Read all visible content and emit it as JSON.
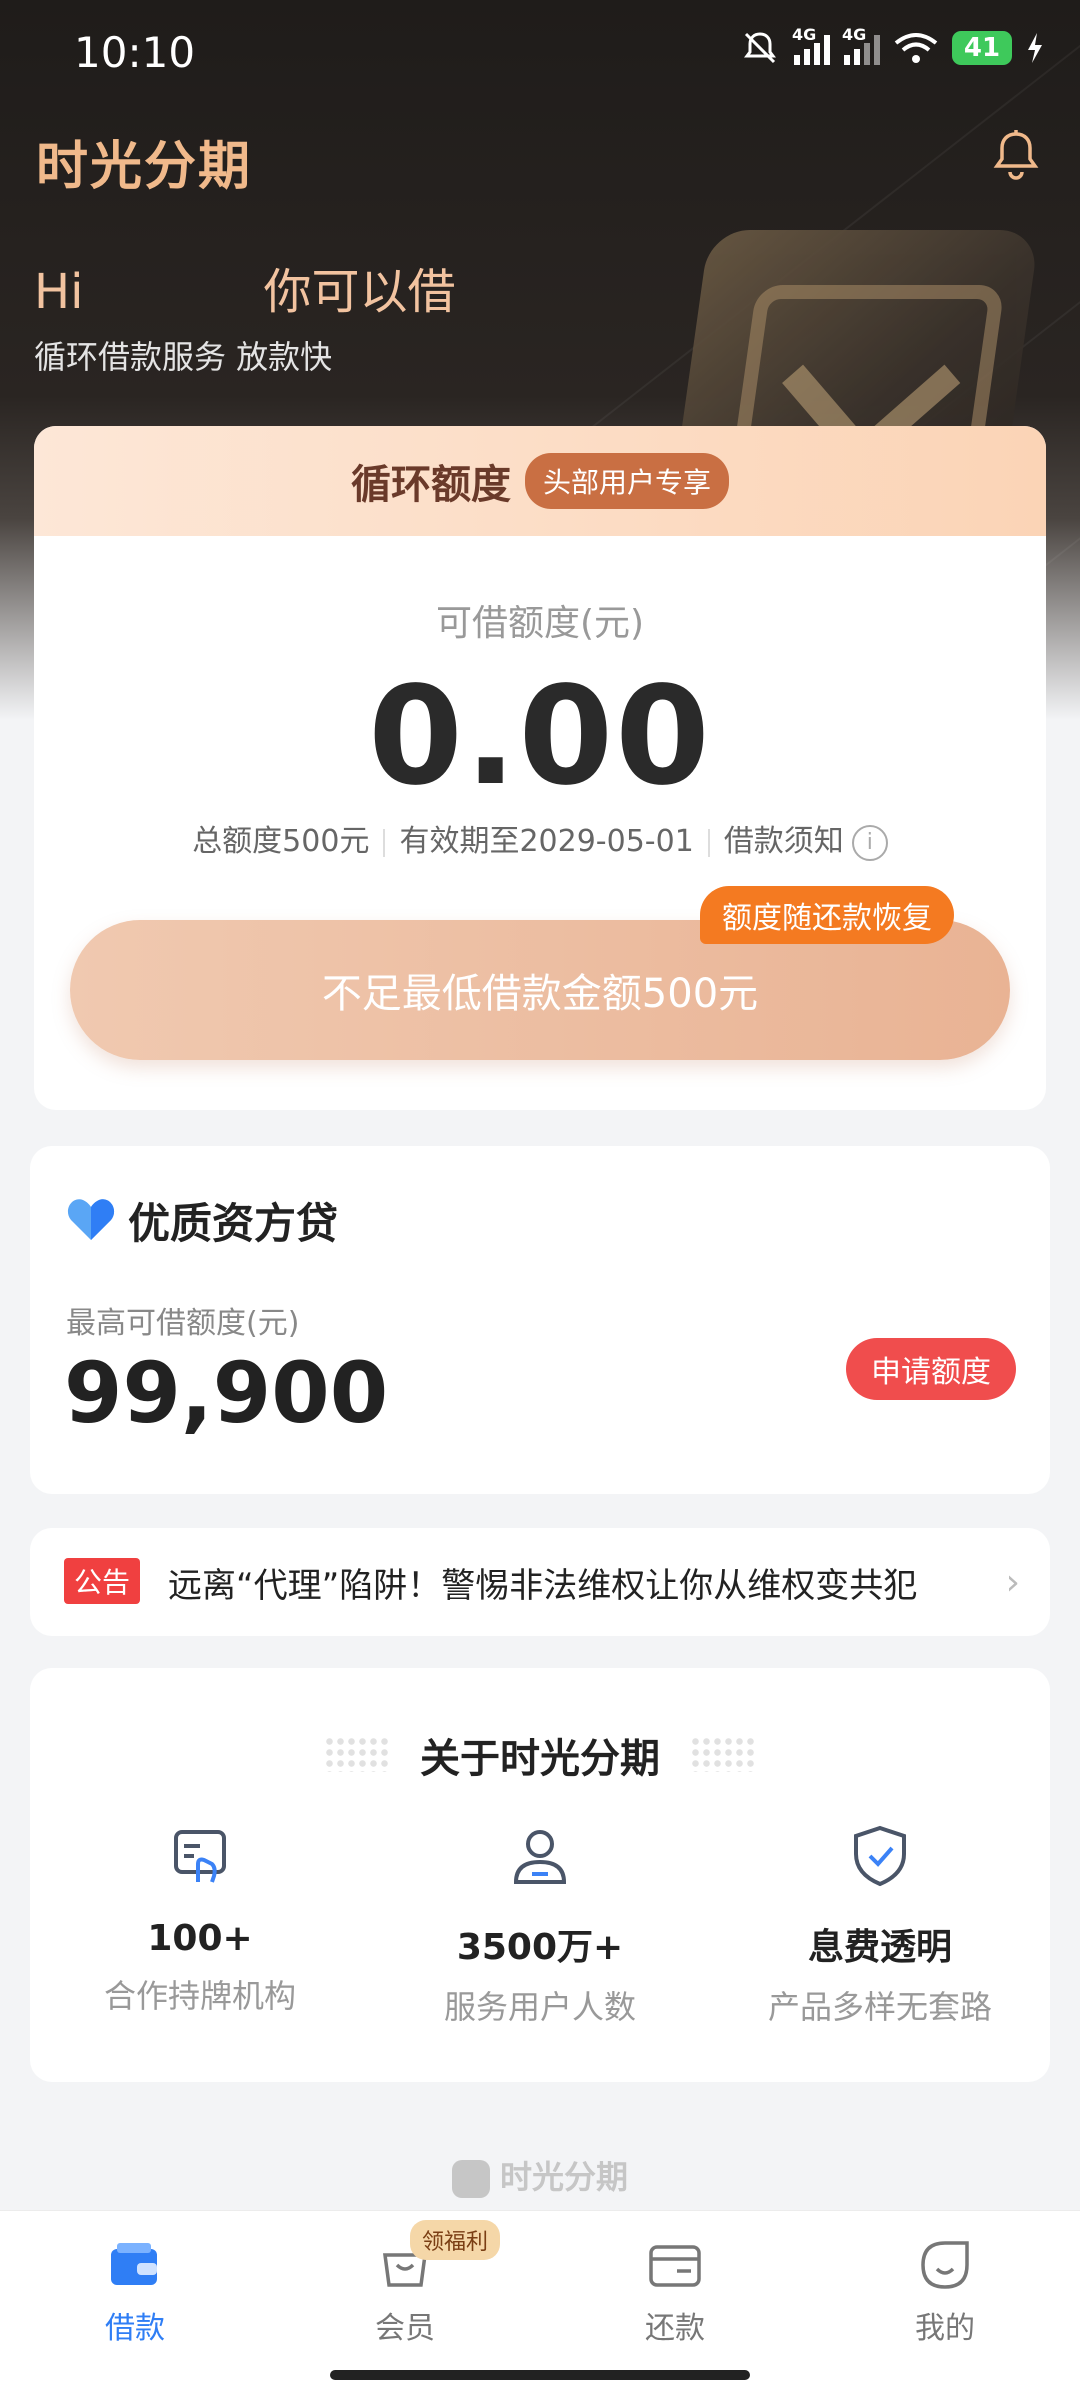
{
  "status_bar": {
    "time": "10:10",
    "signal_label_1": "4G",
    "signal_label_2": "4G",
    "battery": "41"
  },
  "header": {
    "brand": "时光分期",
    "greeting_prefix": "Hi",
    "greeting_suffix": "你可以借",
    "subtitle": "循环借款服务 放款快"
  },
  "credit_card": {
    "title": "循环额度",
    "badge": "头部用户专享",
    "available_label": "可借额度(元)",
    "available_amount": "0.00",
    "total": "总额度500元",
    "expiry": "有效期至2029-05-01",
    "notice_link": "借款须知",
    "cta": "不足最低借款金额500元",
    "bubble": "额度随还款恢复"
  },
  "premium_card": {
    "title": "优质资方贷",
    "label": "最高可借额度(元)",
    "amount": "99,900",
    "button": "申请额度"
  },
  "announcement": {
    "tag": "公告",
    "text": "远离“代理”陷阱！警惕非法维权让你从维权变共犯"
  },
  "about": {
    "title": "关于时光分期",
    "stats": [
      {
        "value": "100+",
        "label": "合作持牌机构"
      },
      {
        "value": "3500万+",
        "label": "服务用户人数"
      },
      {
        "value": "息费透明",
        "label": "产品多样无套路"
      }
    ]
  },
  "footer": {
    "logo_text": "时光分期"
  },
  "tabbar": {
    "items": [
      {
        "label": "借款"
      },
      {
        "label": "会员"
      },
      {
        "label": "还款"
      },
      {
        "label": "我的"
      }
    ],
    "member_badge": "领福利"
  },
  "colors": {
    "accent": "#2f7ef5",
    "brand_gold": "#f0b98b",
    "red": "#f04d4d",
    "orange": "#f47a21"
  }
}
